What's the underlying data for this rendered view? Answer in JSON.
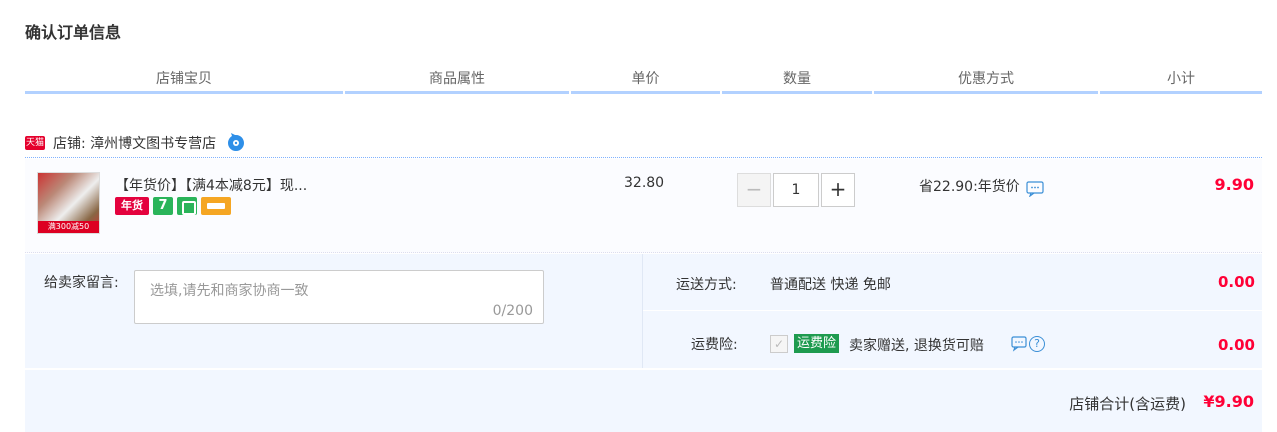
{
  "page": {
    "title": "确认订单信息"
  },
  "header": {
    "columns": [
      "店铺宝贝",
      "商品属性",
      "单价",
      "数量",
      "优惠方式",
      "小计"
    ]
  },
  "shop": {
    "badge": "天猫",
    "name": "店铺: 漳州博文图书专营店"
  },
  "item": {
    "thumb_band": "满300减50",
    "title": "【年货价】【满4本减8元】现...",
    "tags": {
      "nianhuo": "年货",
      "seven_days": "7"
    },
    "unit_price": "32.80",
    "quantity": "1",
    "discount": "省22.90:年货价",
    "subtotal": "9.90"
  },
  "message": {
    "label": "给卖家留言:",
    "placeholder": "选填,请先和商家协商一致",
    "counter": "0/200"
  },
  "shipping": {
    "label": "运送方式:",
    "method": "普通配送 快递 免邮",
    "fee": "0.00"
  },
  "insurance": {
    "label": "运费险:",
    "badge": "运费险",
    "text": "卖家赠送, 退换货可赔",
    "fee": "0.00"
  },
  "total": {
    "label": "店铺合计(含运费)",
    "amount": "¥9.90"
  },
  "colors": {
    "price_red": "#ff0036",
    "header_border": "#b2d1ff",
    "panel_bg": "#f2f7ff",
    "tmall_red": "#e5002c",
    "insurance_green": "#1e9b4f"
  }
}
